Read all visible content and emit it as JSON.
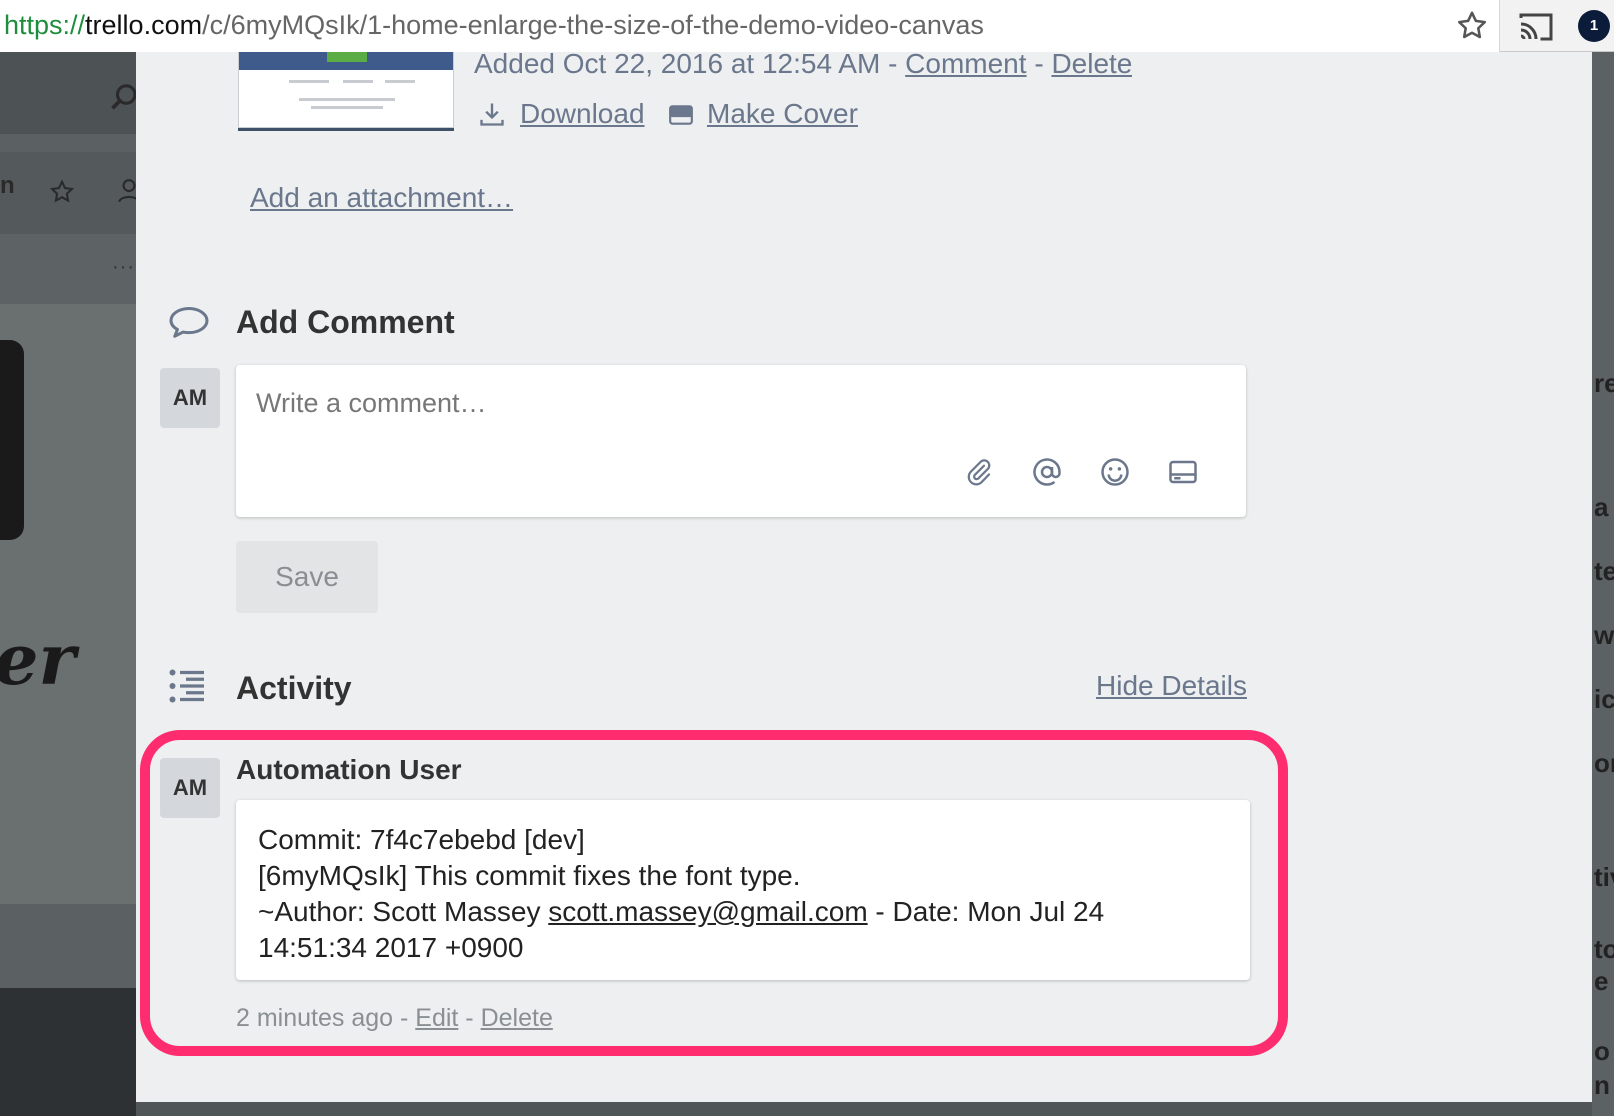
{
  "browser": {
    "url_scheme": "https://",
    "url_host": "trello.com",
    "url_path": "/c/6myMQsIk/1-home-enlarge-the-size-of-the-demo-video-canvas",
    "extension_badge": "1"
  },
  "background": {
    "letter_m": "n",
    "right_fragments": [
      "re",
      "a",
      "te",
      "w",
      "ic",
      "or",
      "tiv",
      "to",
      "e",
      "o",
      "n"
    ]
  },
  "attachment": {
    "added_prefix": "Added Oct 22, 2016 at 12:54 AM - ",
    "comment_link": "Comment",
    "separator": " - ",
    "delete_link": "Delete",
    "download_label": "Download",
    "make_cover_label": "Make Cover",
    "add_attachment_label": "Add an attachment…"
  },
  "add_comment": {
    "title": "Add Comment",
    "avatar_initials": "AM",
    "placeholder": "Write a comment…",
    "save_label": "Save"
  },
  "activity": {
    "title": "Activity",
    "hide_details_label": "Hide Details",
    "entry": {
      "avatar_initials": "AM",
      "author": "Automation User",
      "line1": "Commit: 7f4c7ebebd [dev]",
      "line2": "[6myMQsIk] This commit fixes the font type.",
      "line3_prefix": "~Author: Scott Massey ",
      "email": "scott.massey@gmail.com",
      "line3_suffix": " - Date: Mon Jul 24",
      "line4": "14:51:34 2017 +0900",
      "time_ago": "2 minutes ago",
      "meta_sep": " - ",
      "edit_label": "Edit",
      "delete_label": "Delete"
    }
  },
  "colors": {
    "highlight": "#ff2d6f",
    "link_muted": "#6b778c",
    "card_bg": "#edeff0"
  }
}
